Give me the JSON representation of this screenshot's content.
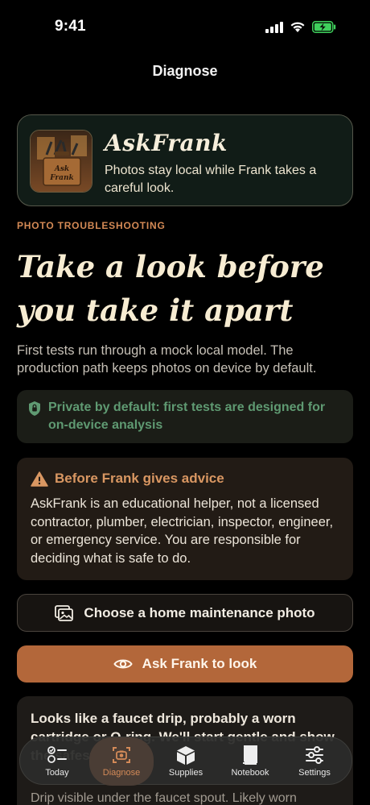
{
  "status": {
    "time": "9:41"
  },
  "nav": {
    "title": "Diagnose"
  },
  "hero": {
    "app_name": "AskFrank",
    "subtitle": "Photos stay local while Frank takes a careful look.",
    "thumbnail_text": "Ask Frank"
  },
  "section": {
    "eyebrow": "PHOTO TROUBLESHOOTING",
    "headline": "Take a look before you take it apart",
    "lead": "First tests run through a mock local model. The production path keeps photos on device by default."
  },
  "privacy": {
    "text": "Private by default: first tests are designed for on-device analysis",
    "icon": "shield-icon",
    "color": "#5f9a72"
  },
  "warning": {
    "title": "Before Frank gives advice",
    "body": "AskFrank is an educational helper, not a licensed contractor, plumber, electrician, inspector, engineer, or emergency service. You are responsible for deciding what is safe to do.",
    "icon": "warning-triangle-icon",
    "color": "#d99762"
  },
  "actions": {
    "choose_label": "Choose a home maintenance photo",
    "ask_label": "Ask Frank to look",
    "accent": "#b3673a"
  },
  "result": {
    "title": "Looks like a faucet drip, probably a worn cartridge or O-ring. We'll start gentle and show the safest fix first.",
    "body": "Drip visible under the faucet spout. Likely worn"
  },
  "tabs": [
    {
      "label": "Today",
      "icon": "today-list-icon"
    },
    {
      "label": "Diagnose",
      "icon": "camera-scan-icon",
      "active": true
    },
    {
      "label": "Supplies",
      "icon": "box-icon"
    },
    {
      "label": "Notebook",
      "icon": "book-icon"
    },
    {
      "label": "Settings",
      "icon": "sliders-icon"
    }
  ]
}
